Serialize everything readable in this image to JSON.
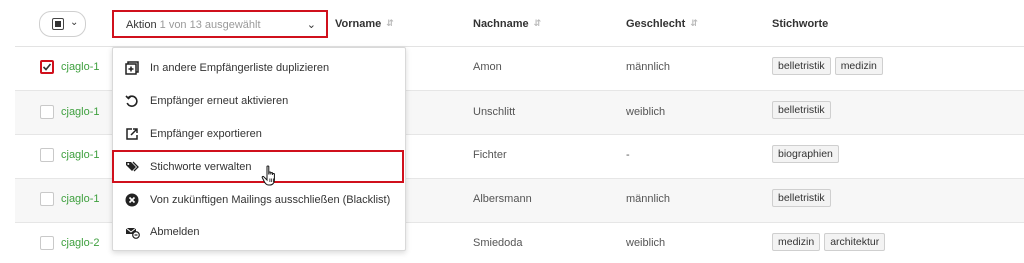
{
  "header": {
    "action_label": "Aktion",
    "action_selection": "1 von 13 ausgewählt",
    "columns": [
      "Vorname",
      "Nachname",
      "Geschlecht",
      "Stichworte"
    ]
  },
  "menu": {
    "items": [
      {
        "label": "In andere Empfängerliste duplizieren",
        "icon": "duplicate-icon"
      },
      {
        "label": "Empfänger erneut aktivieren",
        "icon": "reactivate-icon"
      },
      {
        "label": "Empfänger exportieren",
        "icon": "export-icon"
      },
      {
        "label": "Stichworte verwalten",
        "icon": "tags-icon"
      },
      {
        "label": "Von zukünftigen Mailings ausschließen (Blacklist)",
        "icon": "blacklist-icon"
      },
      {
        "label": "Abmelden",
        "icon": "unsubscribe-icon"
      }
    ]
  },
  "rows": [
    {
      "email": "cjaglo-1",
      "checked": true,
      "firstname": "",
      "lastname": "Amon",
      "gender": "männlich",
      "tags": [
        "belletristik",
        "medizin"
      ]
    },
    {
      "email": "cjaglo-1",
      "checked": false,
      "firstname": "",
      "lastname": "Unschlitt",
      "gender": "weiblich",
      "tags": [
        "belletristik"
      ]
    },
    {
      "email": "cjaglo-1",
      "checked": false,
      "firstname": "",
      "lastname": "Fichter",
      "gender": "-",
      "tags": [
        "biographien"
      ]
    },
    {
      "email": "cjaglo-1",
      "checked": false,
      "firstname": "",
      "lastname": "Albersmann",
      "gender": "männlich",
      "tags": [
        "belletristik"
      ]
    },
    {
      "email": "cjaglo-2",
      "checked": false,
      "firstname": "",
      "lastname": "Smiedoda",
      "gender": "weiblich",
      "tags": [
        "medizin",
        "architektur"
      ]
    }
  ],
  "colors": {
    "highlight": "#d0101c",
    "email": "#3fa03f",
    "alt_row": "#f7f7f7"
  }
}
